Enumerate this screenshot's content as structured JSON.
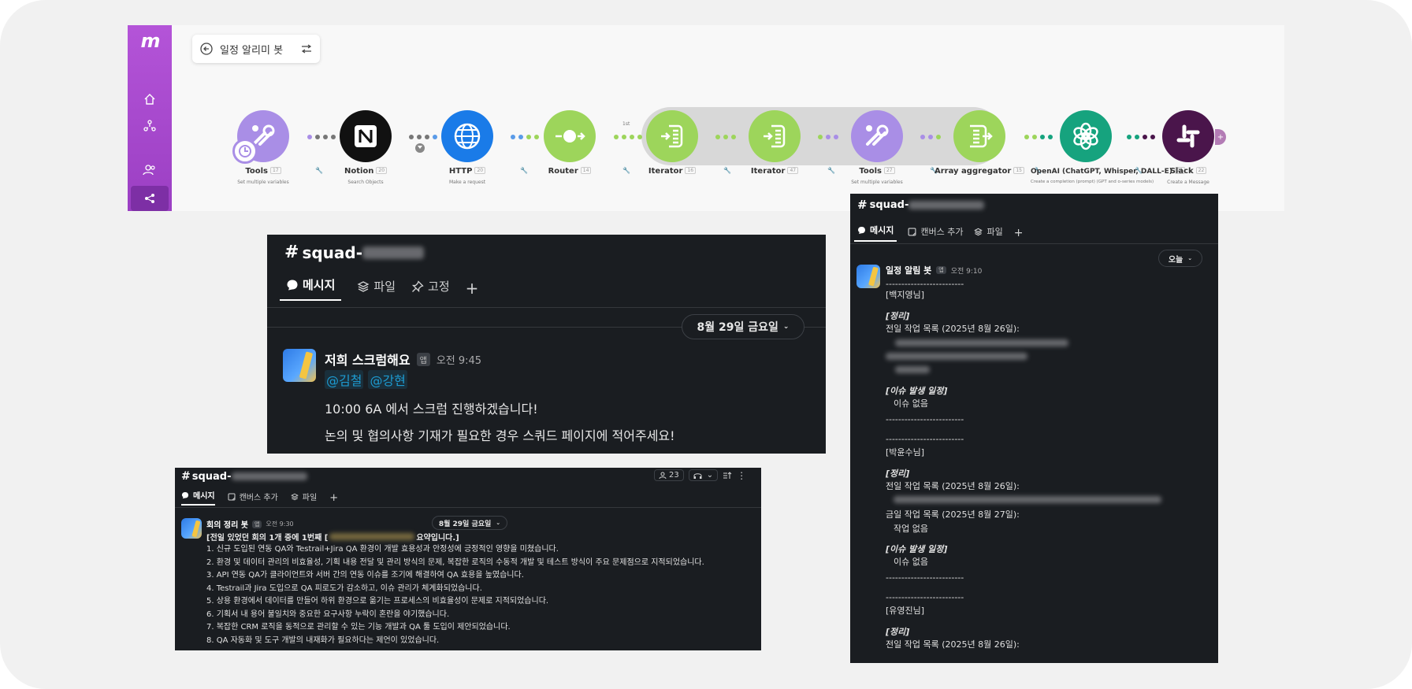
{
  "make": {
    "logo": "m",
    "scenario_title": "일정 알리미 봇",
    "router_count": "1st",
    "modules": [
      {
        "name": "Tools",
        "id": "17",
        "desc": "Set multiple variables",
        "color": "#a98ee6",
        "icon": "tools-icon"
      },
      {
        "name": "Notion",
        "id": "20",
        "desc": "Search Objects",
        "color": "#111111",
        "icon": "notion-icon"
      },
      {
        "name": "HTTP",
        "id": "20",
        "desc": "Make a request",
        "color": "#1a7be8",
        "icon": "globe-icon"
      },
      {
        "name": "Router",
        "id": "14",
        "desc": "",
        "color": "#9dd55b",
        "icon": "router-icon"
      },
      {
        "name": "Iterator",
        "id": "16",
        "desc": "",
        "color": "#9dd55b",
        "icon": "iterator-icon"
      },
      {
        "name": "Iterator",
        "id": "47",
        "desc": "",
        "color": "#9dd55b",
        "icon": "iterator-icon"
      },
      {
        "name": "Tools",
        "id": "27",
        "desc": "Set multiple variables",
        "color": "#a98ee6",
        "icon": "tools-icon"
      },
      {
        "name": "Array aggregator",
        "id": "15",
        "desc": "",
        "color": "#9dd55b",
        "icon": "aggregator-icon"
      },
      {
        "name": "OpenAI (ChatGPT, Whisper, DALL-E)",
        "id": "21",
        "desc": "Create a completion (prompt) (GPT and o-series models)",
        "color": "#16a37e",
        "icon": "openai-icon"
      },
      {
        "name": "Slack",
        "id": "22",
        "desc": "Create a Message",
        "color": "#4a154b",
        "icon": "slack-icon"
      }
    ]
  },
  "slackA": {
    "channel": "squad-",
    "tabs": [
      "메시지",
      "파일",
      "고정"
    ],
    "date": "8월 29일 금요일",
    "sender": "저희 스크럼해요",
    "badge": "앱",
    "time": "오전 9:45",
    "mentions": [
      "@김철",
      "@강현"
    ],
    "line1": "10:00 6A 에서 스크럼 진행하겠습니다!",
    "line2": "논의 및 협의사항 기재가 필요한 경우 스쿼드 페이지에 적어주세요!"
  },
  "slackB": {
    "channel": "squad-",
    "members": "23",
    "tabs": [
      "메시지",
      "캔버스 추가",
      "파일"
    ],
    "date": "8월 29일 금요일",
    "sender": "회의 정리 봇",
    "badge": "앱",
    "time": "오전 9:30",
    "heading_pre": "[전일 있었던 회의 1개 중에 1번째 [",
    "heading_post": "요약입니다.]",
    "items": [
      "1. 신규 도입된 연동 QA와 Testrail+Jira QA 환경이 개발 효용성과 안정성에 긍정적인 영향을 미쳤습니다.",
      "2. 환경 및 데이터 관리의 비효율성, 기획 내용 전달 및 관리 방식의 문제, 복잡한 로직의 수동적 개발 및 테스트 방식이 주요 문제점으로 지적되었습니다.",
      "3. API 연동 QA가 클라이언트와 서버 간의 연동 이슈를 조기에 해결하여 QA 효용을 높였습니다.",
      "4. Testrail과 Jira 도입으로 QA 피로도가 감소하고, 이슈 관리가 체계화되었습니다.",
      "5. 상용 환경에서 데이터를 만들어 하위 환경으로 옮기는 프로세스의 비효율성이 문제로 지적되었습니다.",
      "6. 기획서 내 용어 불일치와 중요한 요구사항 누락이 혼란을 야기했습니다.",
      "7. 복잡한 CRM 로직을 동적으로 관리할 수 있는 기능 개발과 QA 툴 도입이 제안되었습니다.",
      "8. QA 자동화 및 도구 개발의 내재화가 필요하다는 제언이 있었습니다."
    ]
  },
  "slackC": {
    "channel": "squad-",
    "tabs": [
      "메시지",
      "캔버스 추가",
      "파일"
    ],
    "date": "오늘",
    "sender": "일정 알림 봇",
    "badge": "앱",
    "time": "오전 9:10",
    "divider": "-------------------------",
    "person1": "[백지영님]",
    "person2": "[박윤수님]",
    "person3": "[유영진님]",
    "label_summary": "[정리]",
    "label_issue": "[이슈 발생 일정]",
    "prev_work": "전일 작업 목록 (2025년 8월 26일):",
    "today_work": "금일 작업 목록 (2025년 8월 27일):",
    "no_work": "작업 없음",
    "no_issue": "이슈 없음"
  }
}
